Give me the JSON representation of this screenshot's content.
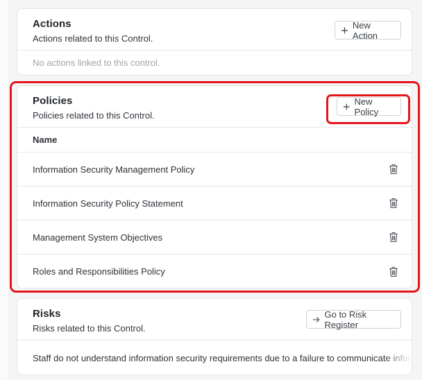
{
  "actions": {
    "title": "Actions",
    "subtitle": "Actions related to this Control.",
    "button_label": "New Action",
    "empty_text": "No actions linked to this control."
  },
  "policies": {
    "title": "Policies",
    "subtitle": "Policies related to this Control.",
    "button_label": "New Policy",
    "column_name": "Name",
    "rows": [
      {
        "name": "Information Security Management Policy",
        "action_icon": "trash-icon"
      },
      {
        "name": "Information Security Policy Statement",
        "action_icon": "trash-icon"
      },
      {
        "name": "Management System Objectives",
        "action_icon": "trash-icon"
      },
      {
        "name": "Roles and Responsibilities Policy",
        "action_icon": "trash-icon"
      }
    ]
  },
  "risks": {
    "title": "Risks",
    "subtitle": "Risks related to this Control.",
    "button_label": "Go to Risk Register",
    "rows": [
      {
        "text": "Staff do not understand information security requirements due to a failure to communicate information"
      }
    ]
  },
  "colors": {
    "highlight": "#e3151b",
    "border": "#e2e4e8",
    "muted_text": "#a0a4aa",
    "background": "#f5f5f6"
  }
}
